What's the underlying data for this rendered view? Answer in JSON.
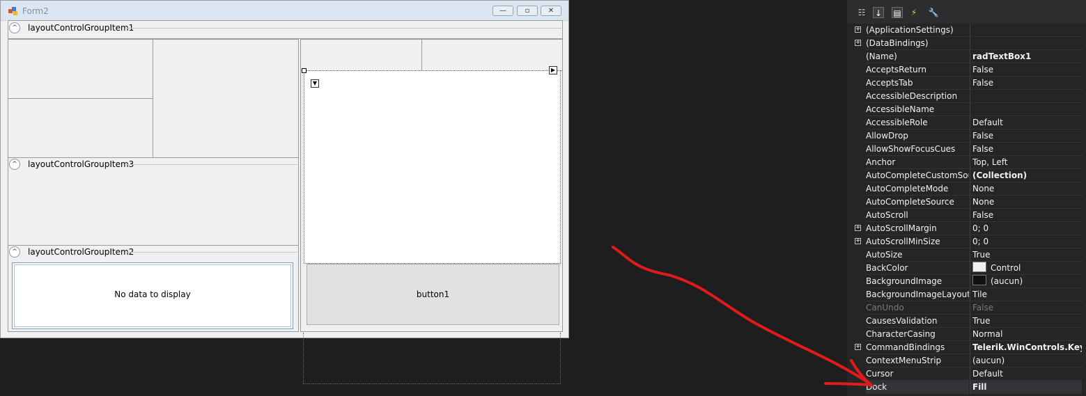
{
  "form": {
    "title": "Form2",
    "groups": [
      {
        "label": "layoutControlGroupItem1"
      },
      {
        "label": "layoutControlGroupItem3"
      },
      {
        "label": "layoutControlGroupItem2"
      }
    ],
    "grid_empty_text": "No data to display",
    "button_label": "button1",
    "collapse_glyph": "^",
    "minimize_glyph": "—",
    "maximize_glyph": "▫",
    "close_glyph": "✕"
  },
  "property_grid": {
    "toolbar_icons": [
      "categorized-icon",
      "alphabetical-icon",
      "properties-icon",
      "events-icon",
      "property-pages-icon"
    ],
    "rows": [
      {
        "name": "(ApplicationSettings)",
        "value": "",
        "expandable": true
      },
      {
        "name": "(DataBindings)",
        "value": "",
        "expandable": true
      },
      {
        "name": "(Name)",
        "value": "radTextBox1",
        "bold": true
      },
      {
        "name": "AcceptsReturn",
        "value": "False"
      },
      {
        "name": "AcceptsTab",
        "value": "False"
      },
      {
        "name": "AccessibleDescription",
        "value": ""
      },
      {
        "name": "AccessibleName",
        "value": ""
      },
      {
        "name": "AccessibleRole",
        "value": "Default"
      },
      {
        "name": "AllowDrop",
        "value": "False"
      },
      {
        "name": "AllowShowFocusCues",
        "value": "False"
      },
      {
        "name": "Anchor",
        "value": "Top, Left"
      },
      {
        "name": "AutoCompleteCustomSource",
        "value": "(Collection)",
        "bold": true
      },
      {
        "name": "AutoCompleteMode",
        "value": "None"
      },
      {
        "name": "AutoCompleteSource",
        "value": "None"
      },
      {
        "name": "AutoScroll",
        "value": "False"
      },
      {
        "name": "AutoScrollMargin",
        "value": "0; 0",
        "expandable": true
      },
      {
        "name": "AutoScrollMinSize",
        "value": "0; 0",
        "expandable": true
      },
      {
        "name": "AutoSize",
        "value": "True"
      },
      {
        "name": "BackColor",
        "value": "Control",
        "swatch": "#f0f0f0"
      },
      {
        "name": "BackgroundImage",
        "value": "(aucun)",
        "swatch": "#111111"
      },
      {
        "name": "BackgroundImageLayout",
        "value": "Tile"
      },
      {
        "name": "CanUndo",
        "value": "False",
        "disabled": true
      },
      {
        "name": "CausesValidation",
        "value": "True"
      },
      {
        "name": "CharacterCasing",
        "value": "Normal"
      },
      {
        "name": "CommandBindings",
        "value": "Telerik.WinControls.Keyboar",
        "bold": true,
        "expandable": true
      },
      {
        "name": "ContextMenuStrip",
        "value": "(aucun)"
      },
      {
        "name": "Cursor",
        "value": "Default"
      },
      {
        "name": "Dock",
        "value": "Fill",
        "bold": true,
        "selected": true
      }
    ]
  },
  "colors": {
    "ide_background": "#1e1e1e",
    "annotation_arrow": "#e01b1b"
  }
}
